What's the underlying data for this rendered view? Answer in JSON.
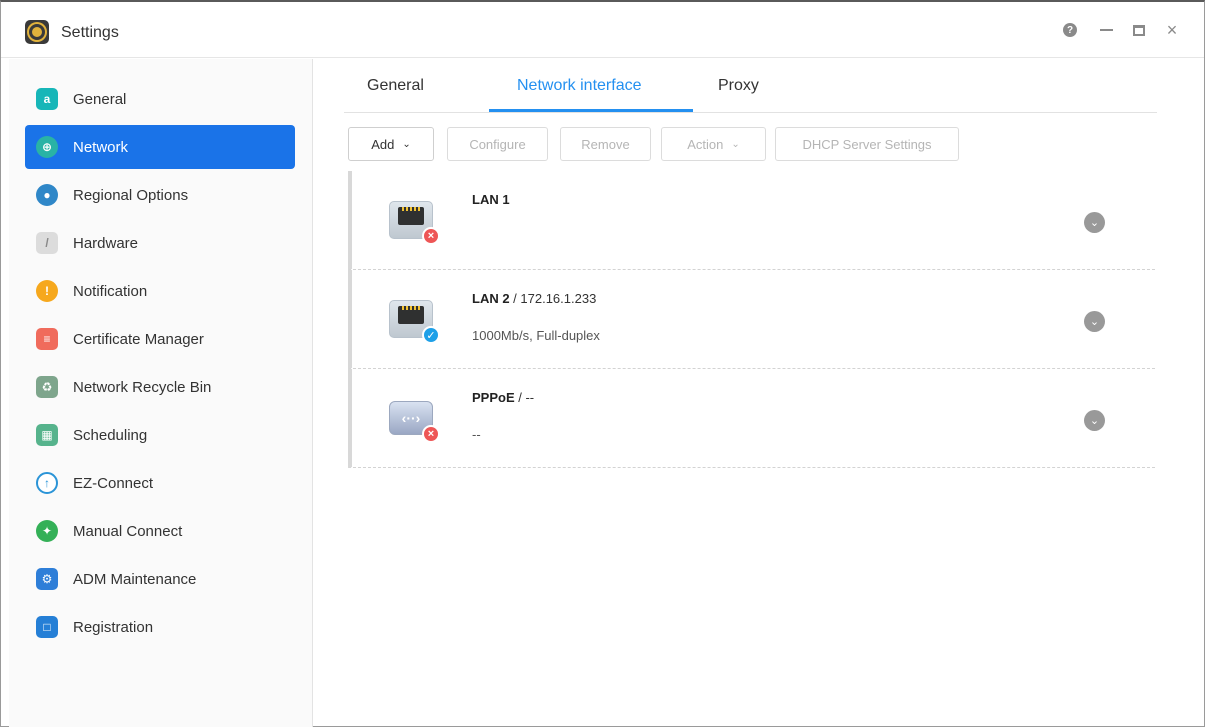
{
  "window": {
    "title": "Settings",
    "controls": {
      "help": "?",
      "close": "×"
    }
  },
  "sidebar": {
    "items": [
      {
        "label": "General",
        "icon": "general-icon",
        "color": "#17b6b8"
      },
      {
        "label": "Network",
        "icon": "globe-icon",
        "color": "#29b3a5",
        "active": true
      },
      {
        "label": "Regional Options",
        "icon": "earth-pin-icon",
        "color": "#2f87c8"
      },
      {
        "label": "Hardware",
        "icon": "wrench-icon",
        "color": "#b7b7b7"
      },
      {
        "label": "Notification",
        "icon": "alert-icon",
        "color": "#f6a81d"
      },
      {
        "label": "Certificate Manager",
        "icon": "certificate-icon",
        "color": "#f06b5c"
      },
      {
        "label": "Network Recycle Bin",
        "icon": "recycle-bin-icon",
        "color": "#7ea58c"
      },
      {
        "label": "Scheduling",
        "icon": "calendar-clock-icon",
        "color": "#56b38c"
      },
      {
        "label": "EZ-Connect",
        "icon": "cloud-upload-icon",
        "color": "#2b94d7"
      },
      {
        "label": "Manual Connect",
        "icon": "network-sphere-icon",
        "color": "#34b057"
      },
      {
        "label": "ADM Maintenance",
        "icon": "maintenance-icon",
        "color": "#2e7ed8"
      },
      {
        "label": "Registration",
        "icon": "registration-icon",
        "color": "#257fd6"
      }
    ]
  },
  "tabs": [
    {
      "label": "General"
    },
    {
      "label": "Network interface",
      "active": true
    },
    {
      "label": "Proxy"
    }
  ],
  "toolbar": {
    "add": "Add",
    "configure": "Configure",
    "remove": "Remove",
    "action": "Action",
    "dhcp": "DHCP Server Settings"
  },
  "interfaces": [
    {
      "name": "LAN 1",
      "address": "",
      "detail": "",
      "status": "disconnected",
      "type": "ethernet-port-icon"
    },
    {
      "name": "LAN 2",
      "address": " / 172.16.1.233",
      "detail": "1000Mb/s, Full-duplex",
      "status": "connected",
      "type": "ethernet-port-icon"
    },
    {
      "name": "PPPoE",
      "address": " / --",
      "detail": "--",
      "status": "disconnected",
      "type": "pppoe-icon"
    }
  ],
  "colors": {
    "accent": "#1a73e8",
    "tab_active": "#2490f0",
    "error": "#ee5656",
    "connected": "#1ea0e8"
  }
}
